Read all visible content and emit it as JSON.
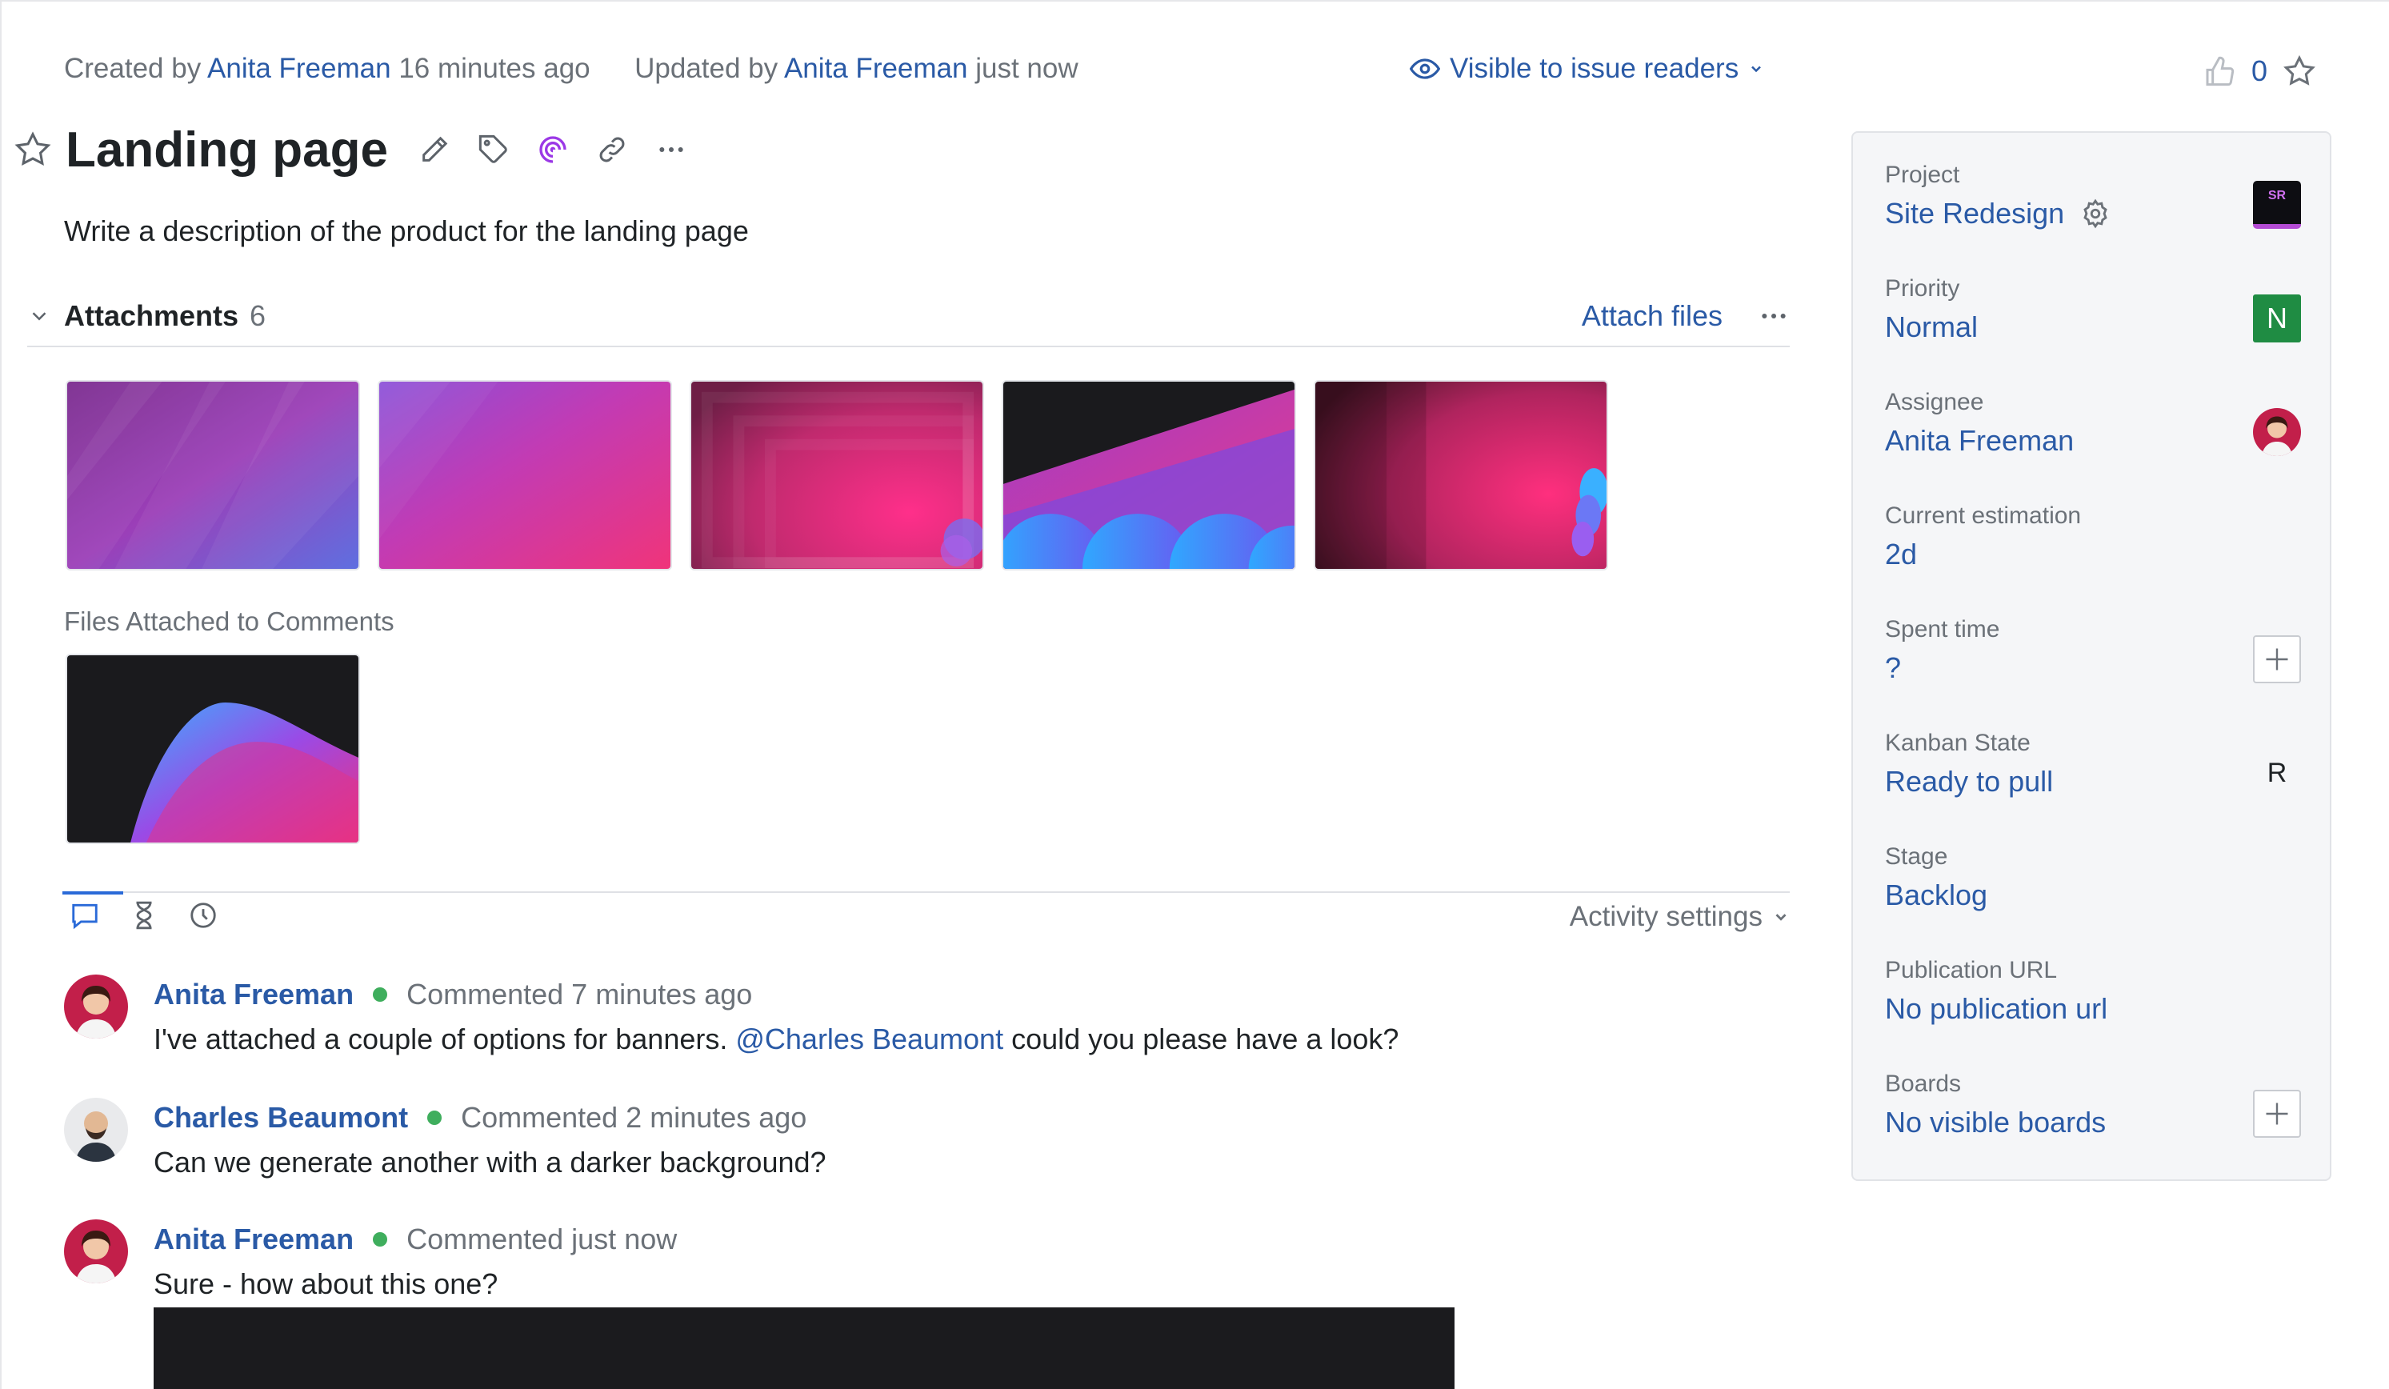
{
  "meta": {
    "created_prefix": "Created by",
    "created_author": "Anita Freeman",
    "created_time": "16 minutes ago",
    "updated_prefix": "Updated by",
    "updated_author": "Anita Freeman",
    "updated_time": "just now",
    "visibility": "Visible to issue readers"
  },
  "votes": {
    "count": "0"
  },
  "issue": {
    "title": "Landing page",
    "description": "Write a description of the product for the landing page"
  },
  "attachments": {
    "label": "Attachments",
    "count": "6",
    "attach_label": "Attach files",
    "comment_files_label": "Files Attached to Comments"
  },
  "activity": {
    "settings_label": "Activity settings"
  },
  "comments": [
    {
      "author": "Anita Freeman",
      "time": "Commented 7 minutes ago",
      "text_before": "I've attached a couple of options for banners. ",
      "mention": "@Charles Beaumont",
      "text_after": " could you please have a look?"
    },
    {
      "author": "Charles Beaumont",
      "time": "Commented 2 minutes ago",
      "text": "Can we generate another with a darker background?"
    },
    {
      "author": "Anita Freeman",
      "time": "Commented just now",
      "text": "Sure - how about this one?"
    }
  ],
  "fields": [
    {
      "label": "Project",
      "value": "Site Redesign",
      "badge": "SR"
    },
    {
      "label": "Priority",
      "value": "Normal",
      "badge": "N"
    },
    {
      "label": "Assignee",
      "value": "Anita Freeman"
    },
    {
      "label": "Current estimation",
      "value": "2d"
    },
    {
      "label": "Spent time",
      "value": "?"
    },
    {
      "label": "Kanban State",
      "value": "Ready to pull",
      "badge": "R"
    },
    {
      "label": "Stage",
      "value": "Backlog"
    },
    {
      "label": "Publication URL",
      "value": "No publication url"
    },
    {
      "label": "Boards",
      "value": "No visible boards"
    }
  ],
  "colors": {
    "link": "#2a5aa6",
    "online": "#3fae5d",
    "priority_normal": "#1f8c43",
    "project_badge": "#b44bd4"
  }
}
